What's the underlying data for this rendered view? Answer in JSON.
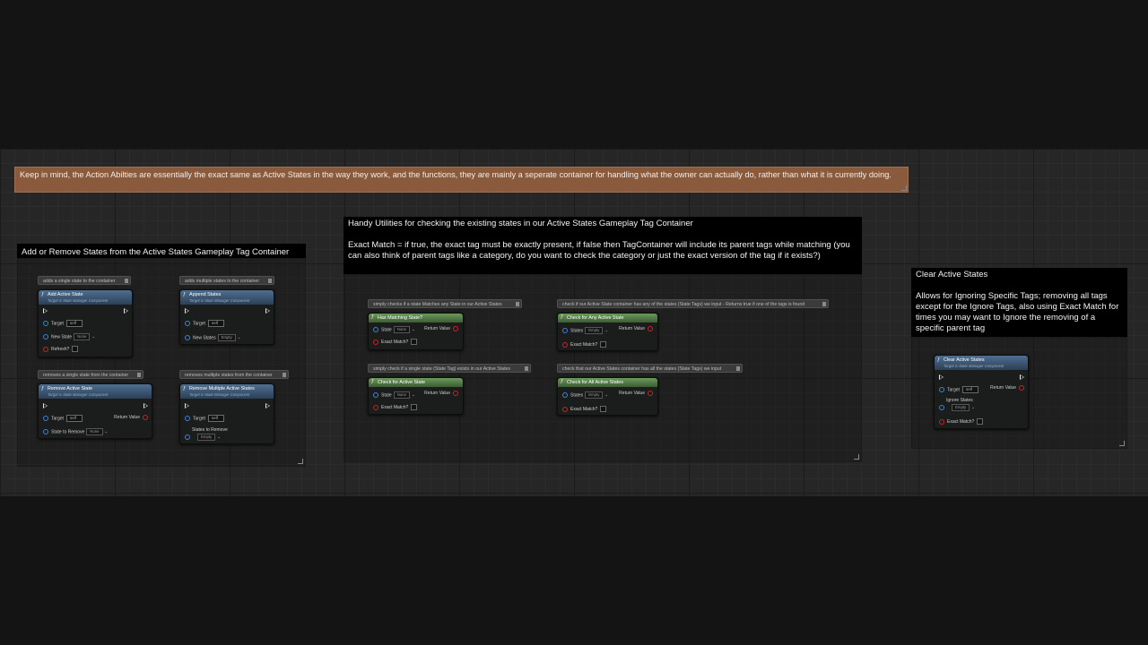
{
  "top_note": "Keep in mind, the Action Abilties are essentially the exact same as Active States in the way they work, and the functions, they are mainly a seperate container for handling what the owner can actually do, rather than what it is currently doing.",
  "comments": {
    "add_remove": {
      "title": "Add or Remove States from the Active States Gameplay Tag Container"
    },
    "utilities": {
      "title": "Handy Utilities for checking the existing states in our Active States Gameplay Tag Container",
      "body": "Exact Match = if true, the exact tag must be exactly present, if false then TagContainer will include its parent tags while matching (you can also think of parent tags like a category, do you want to check the category or just the exact version of the tag if it exists?)"
    },
    "clear": {
      "title": "Clear Active States",
      "body": "Allows for Ignoring Specific Tags; removing all tags except for the Ignore Tags, also using Exact Match for times you may want to Ignore the removing of a specific parent tag"
    }
  },
  "bubbles": {
    "add_single": "adds a single state to the container",
    "add_multi": "adds multiple states to the container",
    "remove_single": "removes a single state from the container",
    "remove_multi": "removes multiple states from the container",
    "matches_any": "simply checks if a state Matches any State in our Active States",
    "any_active": "check if our Active State container has any of the states (State Tags) we input - Returns true if one of the tags is found",
    "single_exists": "simply check if a single state (State Tag) exists in our Active States",
    "all_active": "check that our Active States container has all the states (State Tags) we input"
  },
  "labels": {
    "target_is": "Target is State Manager Component",
    "target": "Target",
    "self": "self",
    "none": "None",
    "empty": "Empty",
    "return_value": "Return Value",
    "exact_match": "Exact Match?",
    "state": "State",
    "states": "States"
  },
  "nodes": {
    "add_active_state": {
      "title": "Add Active State",
      "pin_new_state": "New State",
      "pin_refresh": "Refresh?"
    },
    "append_states": {
      "title": "Append States",
      "pin_new_states": "New States"
    },
    "remove_active_state": {
      "title": "Remove Active State",
      "pin_state_to_remove": "State to Remove"
    },
    "remove_multiple": {
      "title": "Remove Multiple Active States",
      "pin_states_to_remove": "States to Remove"
    },
    "has_matching": {
      "title": "Has Matching State?"
    },
    "check_any": {
      "title": "Check for Any Active State"
    },
    "check_active": {
      "title": "Check for Active State"
    },
    "check_all": {
      "title": "Check for All Active States"
    },
    "clear_active": {
      "title": "Clear Active States",
      "pin_ignore_states": "Ignore States"
    }
  },
  "colors": {
    "note": "#8a5a3d",
    "node_header_blue": "#4e6e91",
    "node_header_green": "#6c9a5c",
    "pin_blue": "#3b84d6",
    "pin_red": "#cc2222"
  }
}
